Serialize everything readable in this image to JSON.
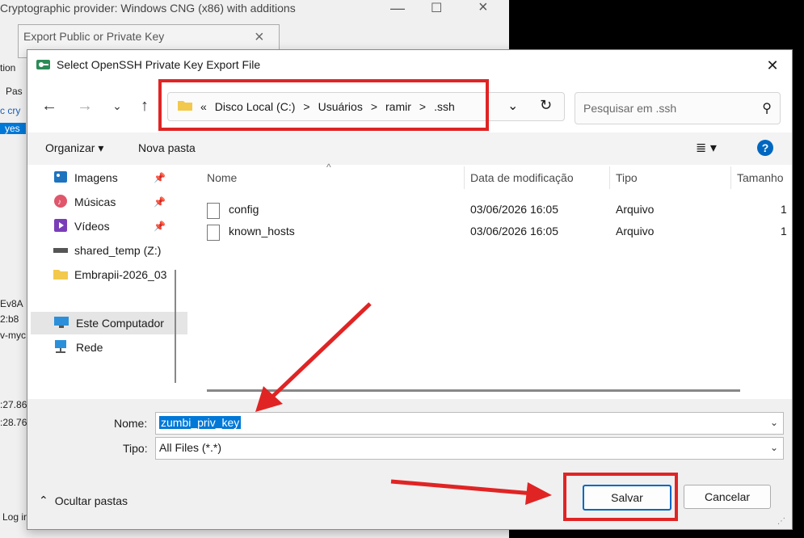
{
  "background": {
    "main_window_title": "Cryptographic provider: Windows CNG (x86) with additions",
    "export_window_title": "Export Public or Private Key",
    "side_fragments": [
      "tion",
      "Pas",
      "c cry",
      "yes",
      "Ev8A",
      "2:b8",
      "v-myc",
      ":27.86",
      ":28.76",
      "Log in"
    ]
  },
  "dialog": {
    "title": "Select OpenSSH Private Key Export File",
    "close_icon": "close-icon",
    "address": {
      "crumbs": [
        "«",
        "Disco Local (C:)",
        ">",
        "Usuários",
        ">",
        "ramir",
        ">",
        ".ssh"
      ]
    },
    "search_placeholder": "Pesquisar em .ssh",
    "toolbar": {
      "organize": "Organizar ▾",
      "new_folder": "Nova pasta"
    },
    "nav_items": [
      {
        "label": "Imagens",
        "icon": "pictures-icon"
      },
      {
        "label": "Músicas",
        "icon": "music-icon"
      },
      {
        "label": "Vídeos",
        "icon": "videos-icon"
      },
      {
        "label": "shared_temp (Z:)",
        "icon": "network-drive-icon"
      },
      {
        "label": "Embrapii-2026_03",
        "icon": "folder-icon"
      },
      {
        "label": "Este Computador",
        "icon": "computer-icon"
      },
      {
        "label": "Rede",
        "icon": "network-icon"
      }
    ],
    "columns": {
      "name": "Nome",
      "modified": "Data de modificação",
      "type": "Tipo",
      "size": "Tamanho"
    },
    "files": [
      {
        "name": "config",
        "modified": "03/06/2026 16:05",
        "type": "Arquivo",
        "size": "1"
      },
      {
        "name": "known_hosts",
        "modified": "03/06/2026 16:05",
        "type": "Arquivo",
        "size": "1"
      }
    ],
    "filename_label": "Nome:",
    "filename_value": "zumbi_priv_key",
    "type_label": "Tipo:",
    "type_value": "All Files (*.*)",
    "hide_folders": "Ocultar pastas",
    "save_button": "Salvar",
    "cancel_button": "Cancelar"
  },
  "colors": {
    "annotation_red": "#e02424",
    "selection_blue": "#0078d7",
    "accent": "#0067c0"
  }
}
